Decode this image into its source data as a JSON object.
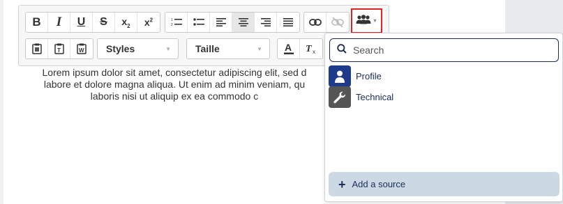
{
  "toolbar": {
    "styles_label": "Styles",
    "size_label": "Taille"
  },
  "editor": {
    "lines": [
      "Lorem ipsum dolor sit amet, consectetur adipiscing elit, sed d",
      "labore et dolore magna aliqua. Ut enim ad minim veniam, qu",
      "laboris nisi ut aliquip ex ea commodo c"
    ]
  },
  "dropdown": {
    "search_placeholder": "Search",
    "options": [
      {
        "label": "Profile",
        "icon": "user-icon",
        "color": "#1e3a8a"
      },
      {
        "label": "Technical",
        "icon": "wrench-icon",
        "color": "#555555"
      }
    ],
    "add_label": "Add a source"
  },
  "colors": {
    "highlight_border": "#e02222",
    "dropdown_accent": "#1b2d4f",
    "add_button_bg": "#ccd9e4"
  }
}
